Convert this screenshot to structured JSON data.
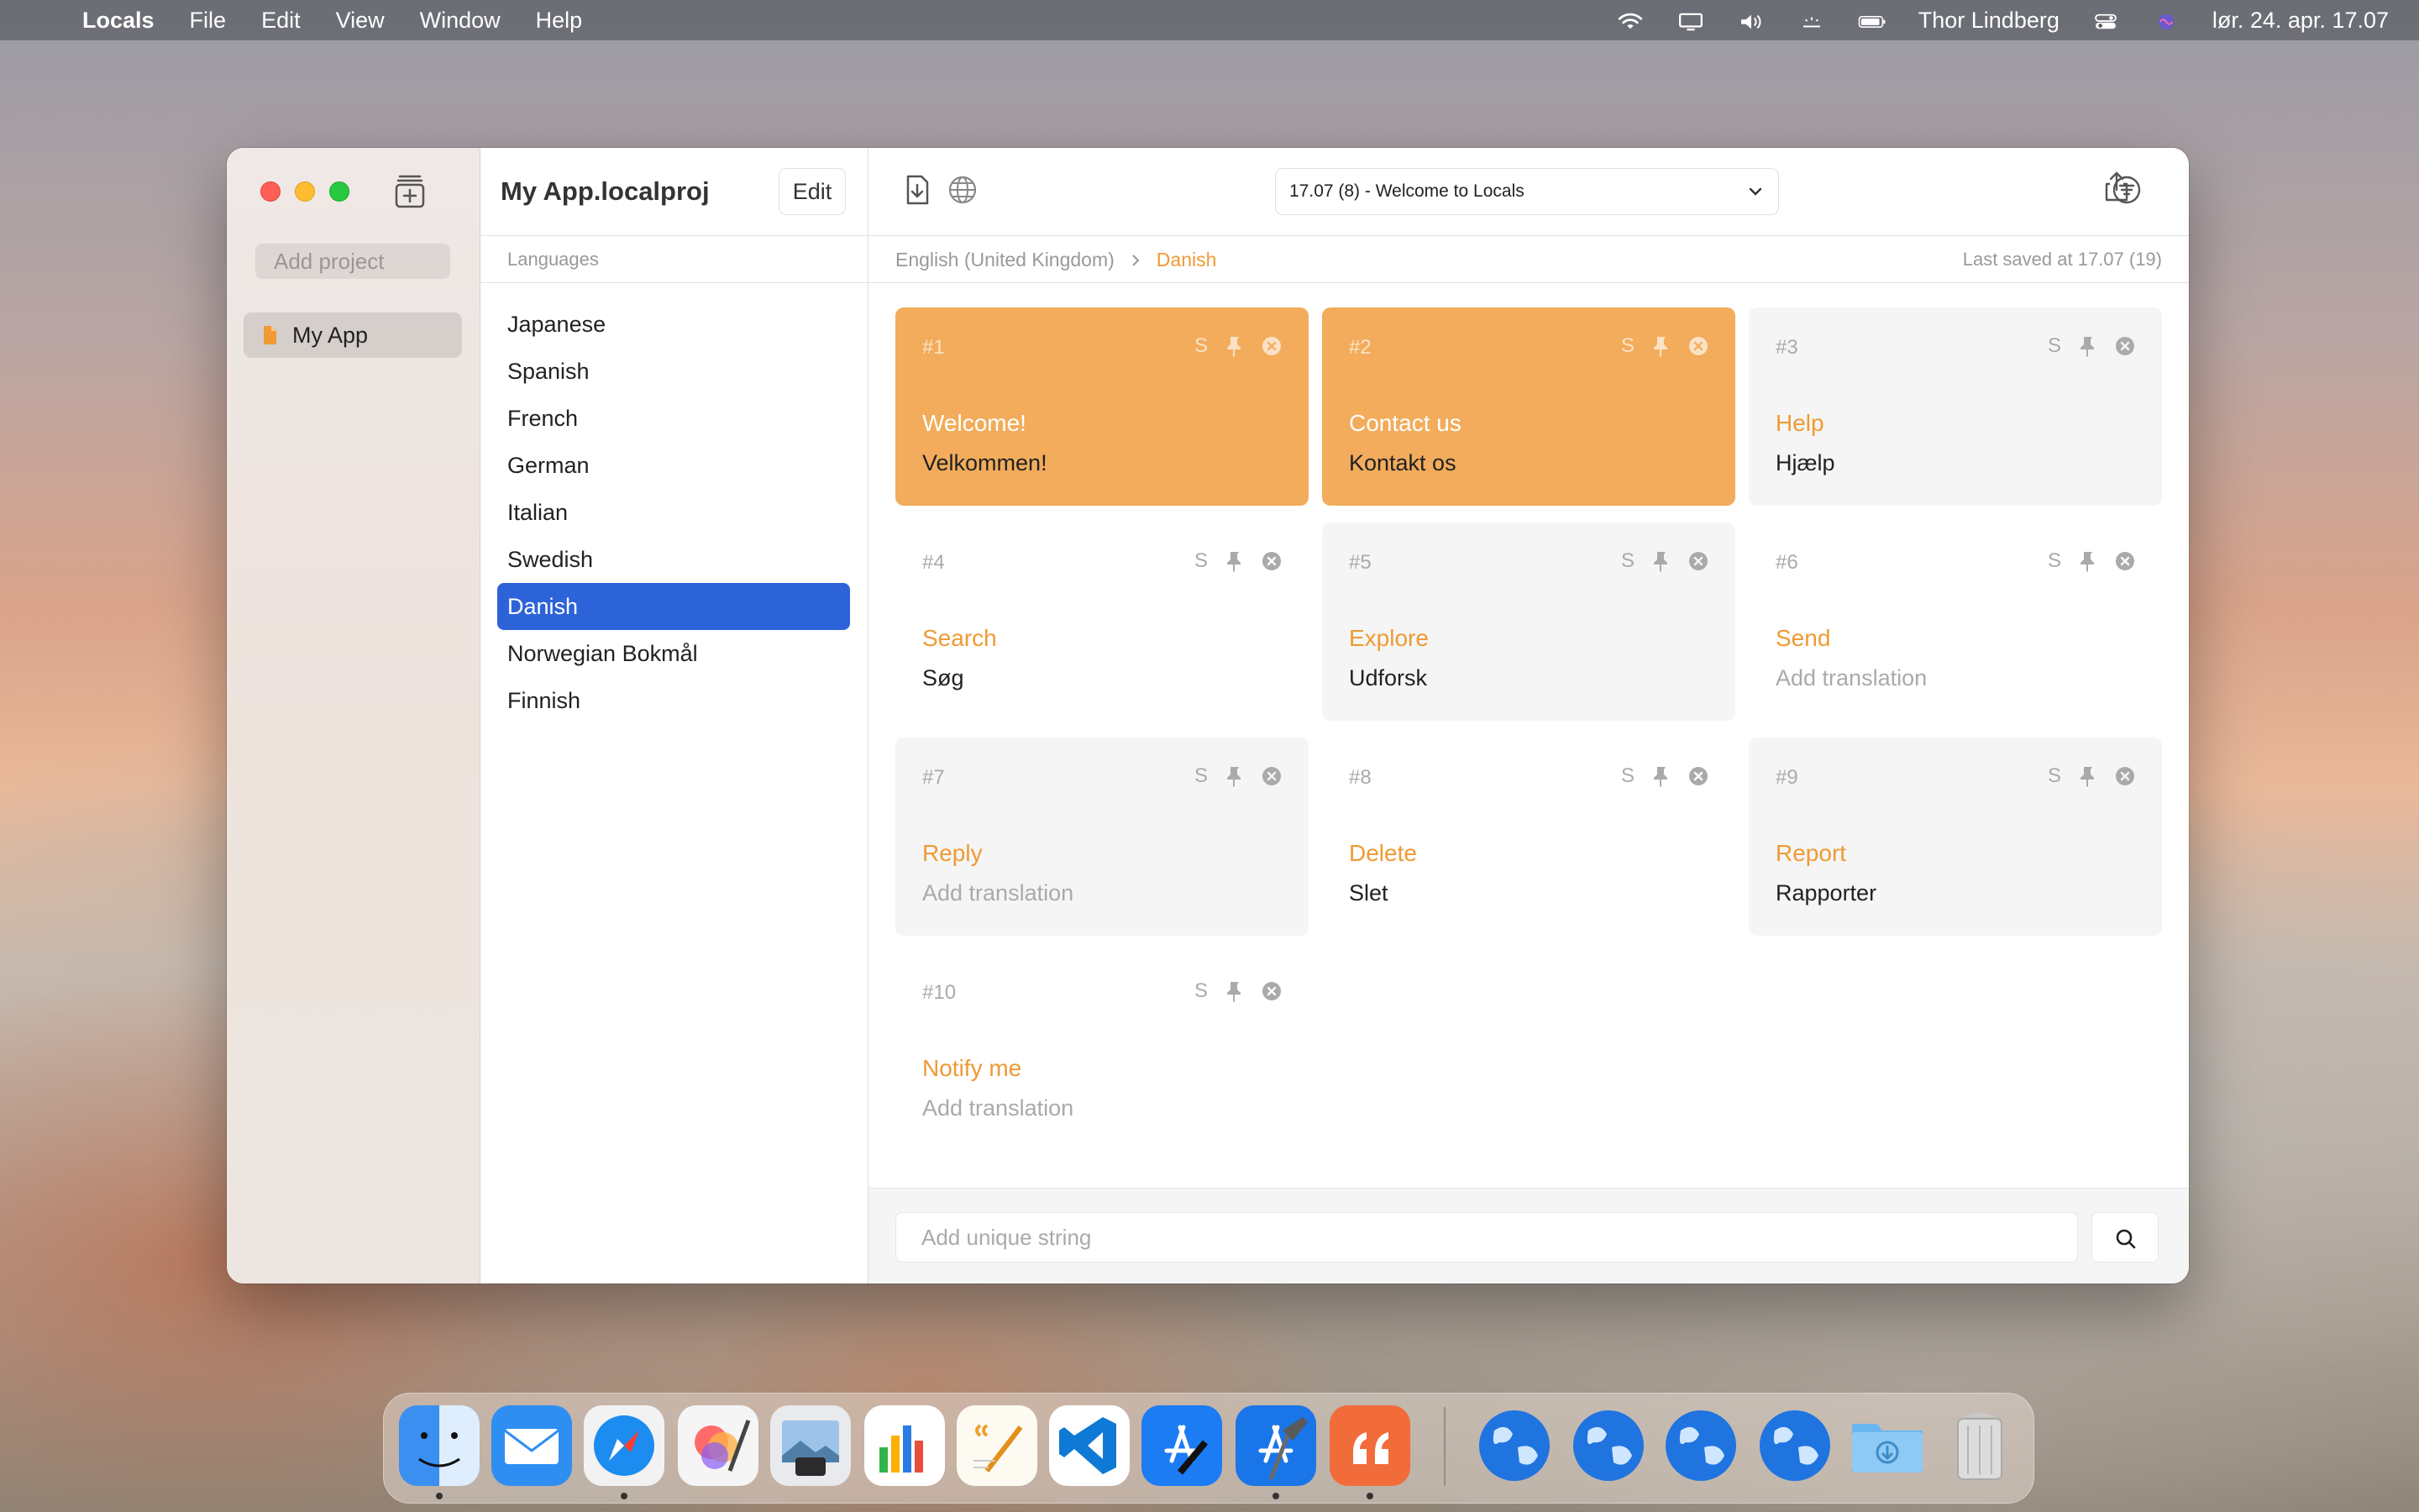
{
  "menubar": {
    "app_name": "Locals",
    "menus": [
      "File",
      "Edit",
      "View",
      "Window",
      "Help"
    ],
    "user": "Thor Lindberg",
    "clock": "lør. 24. apr.  17.07"
  },
  "sidebar": {
    "add_project_placeholder": "Add project",
    "projects": [
      "My App"
    ]
  },
  "languages_panel": {
    "project_title": "My App.localproj",
    "edit_label": "Edit",
    "header": "Languages",
    "languages": [
      "Japanese",
      "Spanish",
      "French",
      "German",
      "Italian",
      "Swedish",
      "Danish",
      "Norwegian Bokmål",
      "Finnish"
    ],
    "selected": "Danish"
  },
  "toolbar": {
    "version_select": "17.07 (8) - Welcome to Locals"
  },
  "breadcrumb": {
    "source": "English (United Kingdom)",
    "target": "Danish"
  },
  "last_saved": "Last saved at 17.07 (19)",
  "cards": [
    {
      "num": "#1",
      "s": "S",
      "key": "Welcome!",
      "value": "Velkommen!",
      "state": "accent"
    },
    {
      "num": "#2",
      "s": "S",
      "key": "Contact us",
      "value": "Kontakt os",
      "state": "accent"
    },
    {
      "num": "#3",
      "s": "S",
      "key": "Help",
      "value": "Hjælp",
      "state": "grey"
    },
    {
      "num": "#4",
      "s": "S",
      "key": "Search",
      "value": "Søg",
      "state": "plain"
    },
    {
      "num": "#5",
      "s": "S",
      "key": "Explore",
      "value": "Udforsk",
      "state": "grey"
    },
    {
      "num": "#6",
      "s": "S",
      "key": "Send",
      "value": "Add translation",
      "state": "plain",
      "empty": true
    },
    {
      "num": "#7",
      "s": "S",
      "key": "Reply",
      "value": "Add translation",
      "state": "grey",
      "empty": true
    },
    {
      "num": "#8",
      "s": "S",
      "key": "Delete",
      "value": "Slet",
      "state": "plain"
    },
    {
      "num": "#9",
      "s": "S",
      "key": "Report",
      "value": "Rapporter",
      "state": "grey"
    },
    {
      "num": "#10",
      "s": "S",
      "key": "Notify me",
      "value": "Add translation",
      "state": "plain",
      "empty": true
    }
  ],
  "bottom": {
    "unique_string_placeholder": "Add unique string"
  },
  "colors": {
    "accent": "#F2AC5C",
    "key_text": "#EF9A34",
    "selection": "#2D63D8"
  }
}
